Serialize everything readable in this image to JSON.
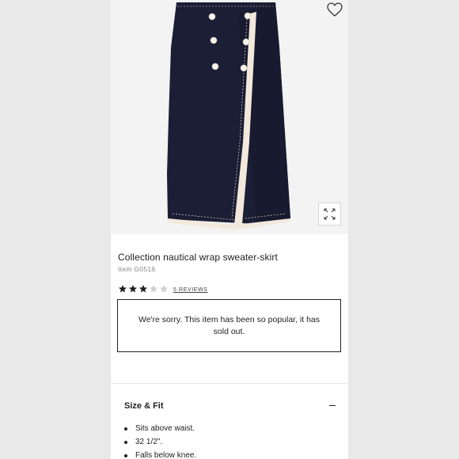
{
  "product": {
    "name": "Collection nautical wrap sweater-skirt",
    "item_number": "Item G0516",
    "image_alt": "navy skirt",
    "rating": {
      "stars_filled": 3,
      "stars_total": 5,
      "reviews_label": "5 REVIEWS"
    },
    "sold_out_message": "We're sorry. This item has been so popular, it has sold out."
  },
  "icons": {
    "favorite": "heart-outline-icon",
    "zoom": "expand-icon",
    "section_toggle": "minus-icon"
  },
  "size_fit": {
    "title": "Size & Fit",
    "items": [
      "Sits above waist.",
      "32 1/2\".",
      "Falls below knee."
    ]
  },
  "colors": {
    "page_background": "#e9e9e9",
    "card_background": "#ffffff",
    "skirt_navy": "#1b1e35",
    "trim_cream": "#f2e9dc",
    "text": "#222222",
    "star_filled": "#222222",
    "star_empty": "#cfcfcf"
  }
}
